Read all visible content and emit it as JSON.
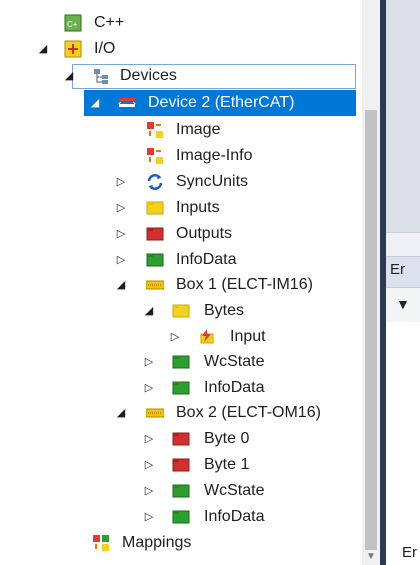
{
  "tree": {
    "items": [
      {
        "label": "C++",
        "icon": "cpp-icon",
        "expanded": null
      },
      {
        "label": "I/O",
        "icon": "io-icon",
        "expanded": true
      },
      {
        "label": "Devices",
        "icon": "devices-icon",
        "expanded": true
      },
      {
        "label": "Device 2 (EtherCAT)",
        "icon": "ethercat-device-icon",
        "expanded": true,
        "selected": true
      },
      {
        "label": "Image",
        "icon": "image-icon",
        "expanded": null
      },
      {
        "label": "Image-Info",
        "icon": "image-info-icon",
        "expanded": null
      },
      {
        "label": "SyncUnits",
        "icon": "syncunits-icon",
        "expanded": false
      },
      {
        "label": "Inputs",
        "icon": "inputs-folder-icon",
        "expanded": false
      },
      {
        "label": "Outputs",
        "icon": "outputs-folder-icon",
        "expanded": false
      },
      {
        "label": "InfoData",
        "icon": "infodata-icon",
        "expanded": false
      },
      {
        "label": "Box 1 (ELCT-IM16)",
        "icon": "box-icon",
        "expanded": true
      },
      {
        "label": "Bytes",
        "icon": "bytes-folder-icon",
        "expanded": true
      },
      {
        "label": "Input",
        "icon": "input-variable-icon",
        "expanded": false
      },
      {
        "label": "WcState",
        "icon": "wcstate-icon",
        "expanded": false
      },
      {
        "label": "InfoData",
        "icon": "infodata-icon",
        "expanded": false
      },
      {
        "label": "Box 2 (ELCT-OM16)",
        "icon": "box-icon",
        "expanded": true
      },
      {
        "label": "Byte 0",
        "icon": "byte-output-icon",
        "expanded": false
      },
      {
        "label": "Byte 1",
        "icon": "byte-output-icon",
        "expanded": false
      },
      {
        "label": "WcState",
        "icon": "wcstate-icon",
        "expanded": false
      },
      {
        "label": "InfoData",
        "icon": "infodata-icon",
        "expanded": false
      },
      {
        "label": "Mappings",
        "icon": "mappings-icon",
        "expanded": null
      }
    ]
  },
  "right_panel": {
    "header_label": "Er",
    "bottom_label": "Er",
    "filter_icon": "filter-icon"
  },
  "colors": {
    "selection": "#0078d7",
    "folder_yellow": "#f5d020",
    "output_red": "#d32f2f",
    "green": "#2e9e2e"
  }
}
